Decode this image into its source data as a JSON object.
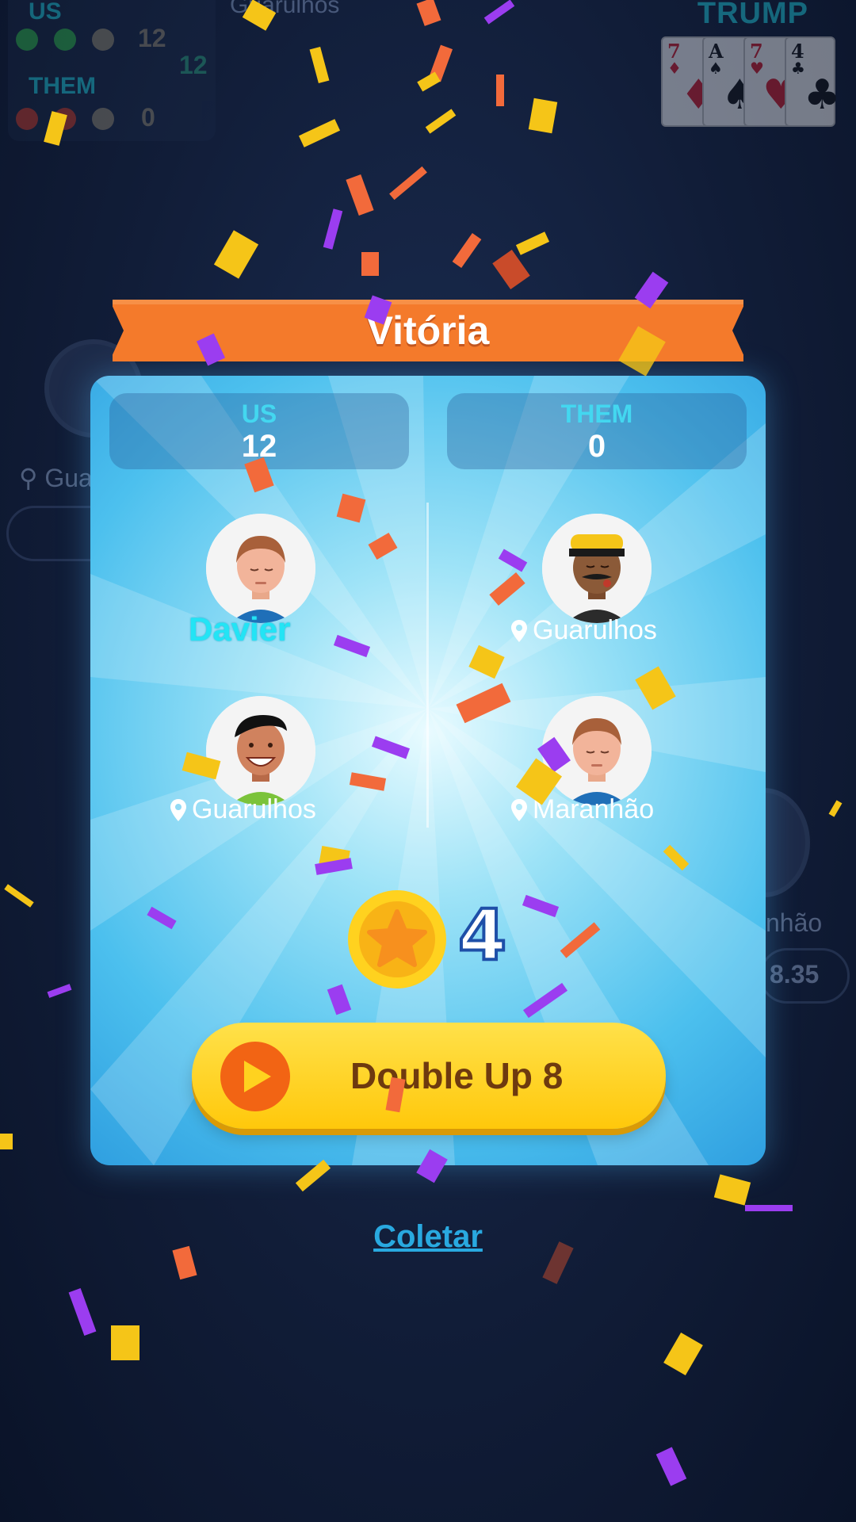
{
  "background": {
    "scoreboard": {
      "us_label": "US",
      "them_label": "THEM",
      "us_score": "12",
      "total_score": "12",
      "them_score": "0"
    },
    "top_location": "Guarulhos",
    "trump": {
      "label": "TRUMP",
      "cards": [
        {
          "rank": "7",
          "suit": "♦",
          "color": "red"
        },
        {
          "rank": "A",
          "suit": "♠",
          "color": "black"
        },
        {
          "rank": "7",
          "suit": "♥",
          "color": "red"
        },
        {
          "rank": "4",
          "suit": "♣",
          "color": "black"
        }
      ]
    },
    "left_location": "Gua",
    "right_location": "nhão",
    "right_value": "8.35"
  },
  "dialog": {
    "title": "Vitória",
    "teams": {
      "us": {
        "label": "US",
        "score": "12"
      },
      "them": {
        "label": "THEM",
        "score": "0"
      }
    },
    "players": [
      {
        "id": "p1",
        "name": "Davier",
        "location": ""
      },
      {
        "id": "p2",
        "name": "",
        "location": "Guarulhos"
      },
      {
        "id": "p3",
        "name": "",
        "location": "Guarulhos"
      },
      {
        "id": "p4",
        "name": "",
        "location": "Maranhão"
      }
    ],
    "reward": {
      "coins": "4",
      "icon": "star-coin-icon"
    },
    "double_up_button": {
      "label": "Double Up 8",
      "icon": "play-icon"
    }
  },
  "collect_link": {
    "label": "Coletar"
  },
  "colors": {
    "ribbon": "#f47a2b",
    "card_accent": "#4cc0ee",
    "button": "#ffc80b",
    "play": "#f26414",
    "link": "#29a9e0"
  }
}
